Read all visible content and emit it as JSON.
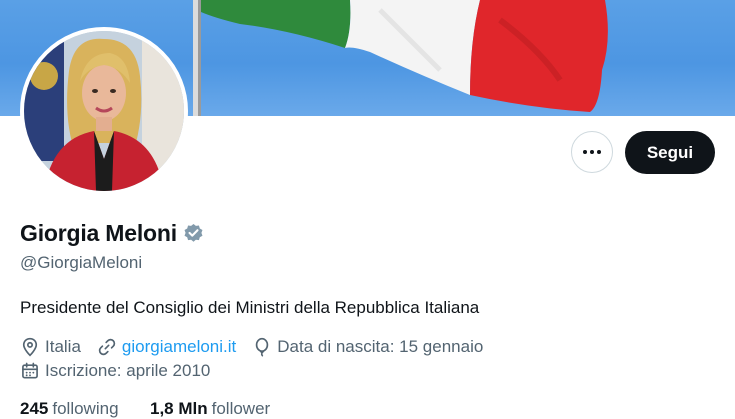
{
  "profile": {
    "display_name": "Giorgia Meloni",
    "handle": "@GiorgiaMeloni",
    "bio": "Presidente del Consiglio dei Ministri della Repubblica Italiana",
    "location": "Italia",
    "website": "giorgiameloni.it",
    "birthday": "Data di nascita: 15 gennaio",
    "joined": "Iscrizione: aprile 2010",
    "following_count": "245",
    "following_label": "following",
    "followers_count": "1,8 Mln",
    "followers_label": "follower"
  },
  "actions": {
    "follow_label": "Segui",
    "more_icon": "more-horizontal-icon"
  },
  "icons": {
    "verified": "verified-badge-icon",
    "location": "location-pin-icon",
    "link": "link-icon",
    "birthday": "balloon-icon",
    "calendar": "calendar-icon"
  },
  "colors": {
    "accent": "#1d9bf0",
    "primary_text": "#0f1419",
    "secondary_text": "#536471",
    "follow_button_bg": "#0f1419"
  }
}
